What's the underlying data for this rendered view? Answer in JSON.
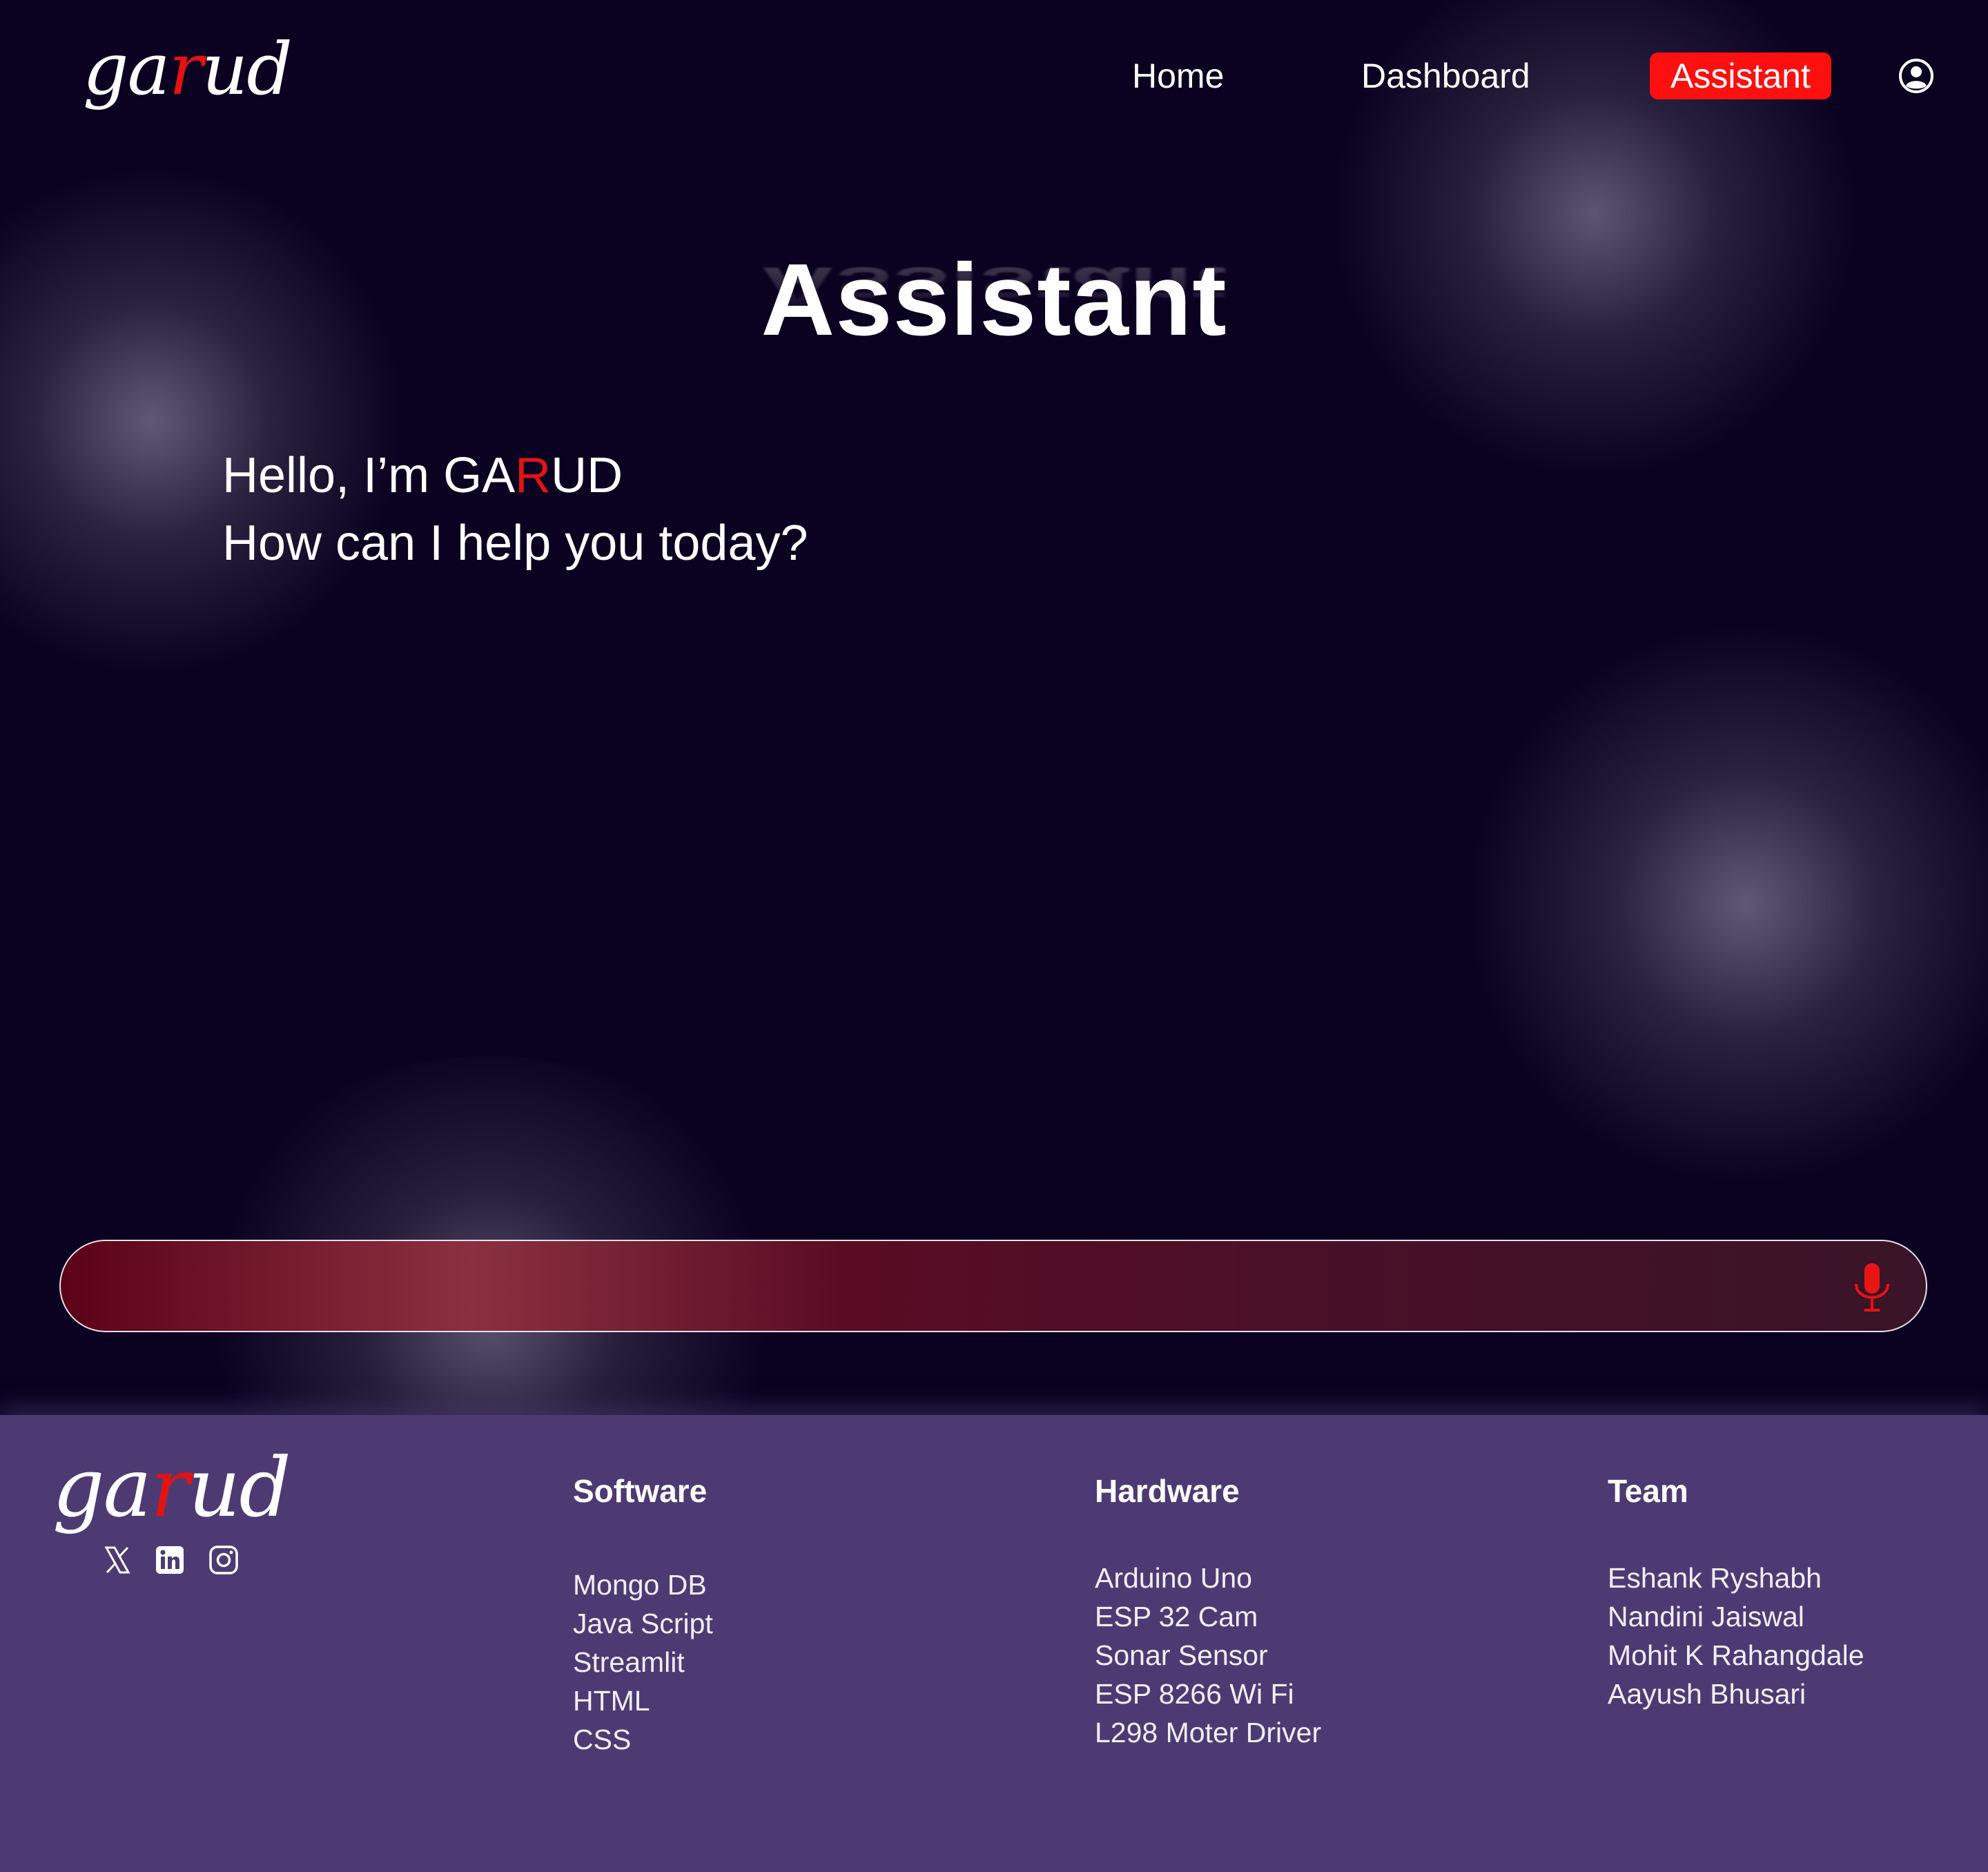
{
  "nav": {
    "logo": {
      "pre": "ga",
      "accent": "r",
      "post": "ud"
    },
    "links": [
      {
        "label": "Home"
      },
      {
        "label": "Dashboard"
      },
      {
        "label": "Assistant",
        "active": true
      }
    ],
    "user_icon": "user-circle-icon"
  },
  "hero": {
    "title": "Assistant",
    "greeting_line1_pre": "Hello, I’m GA",
    "greeting_accent": "R",
    "greeting_line1_post": "UD",
    "greeting_line2": "How can I help you today?"
  },
  "input_bar": {
    "value": "",
    "placeholder": "",
    "icon": "microphone-icon"
  },
  "footer": {
    "logo": {
      "pre": "ga",
      "accent": "r",
      "post": "ud"
    },
    "social": [
      "x-icon",
      "linkedin-icon",
      "instagram-icon"
    ],
    "columns": [
      {
        "heading": "Software",
        "items": [
          "Mongo DB",
          "Java Script",
          "Streamlit",
          "HTML",
          "CSS"
        ]
      },
      {
        "heading": "Hardware",
        "items": [
          "Arduino Uno",
          "ESP 32 Cam",
          "Sonar Sensor",
          "ESP 8266 Wi Fi",
          "L298 Moter Driver"
        ]
      },
      {
        "heading": "Team",
        "items": [
          "Eshank Ryshabh",
          "Nandini Jaiswal",
          "Mohit K Rahangdale",
          "Aayush Bhusari"
        ]
      }
    ]
  },
  "colors": {
    "background": "#0a0220",
    "accent": "#ff1010",
    "footer": "#4e3a73",
    "input_gradient_start": "#5c0218",
    "input_gradient_end": "#3a1428"
  }
}
